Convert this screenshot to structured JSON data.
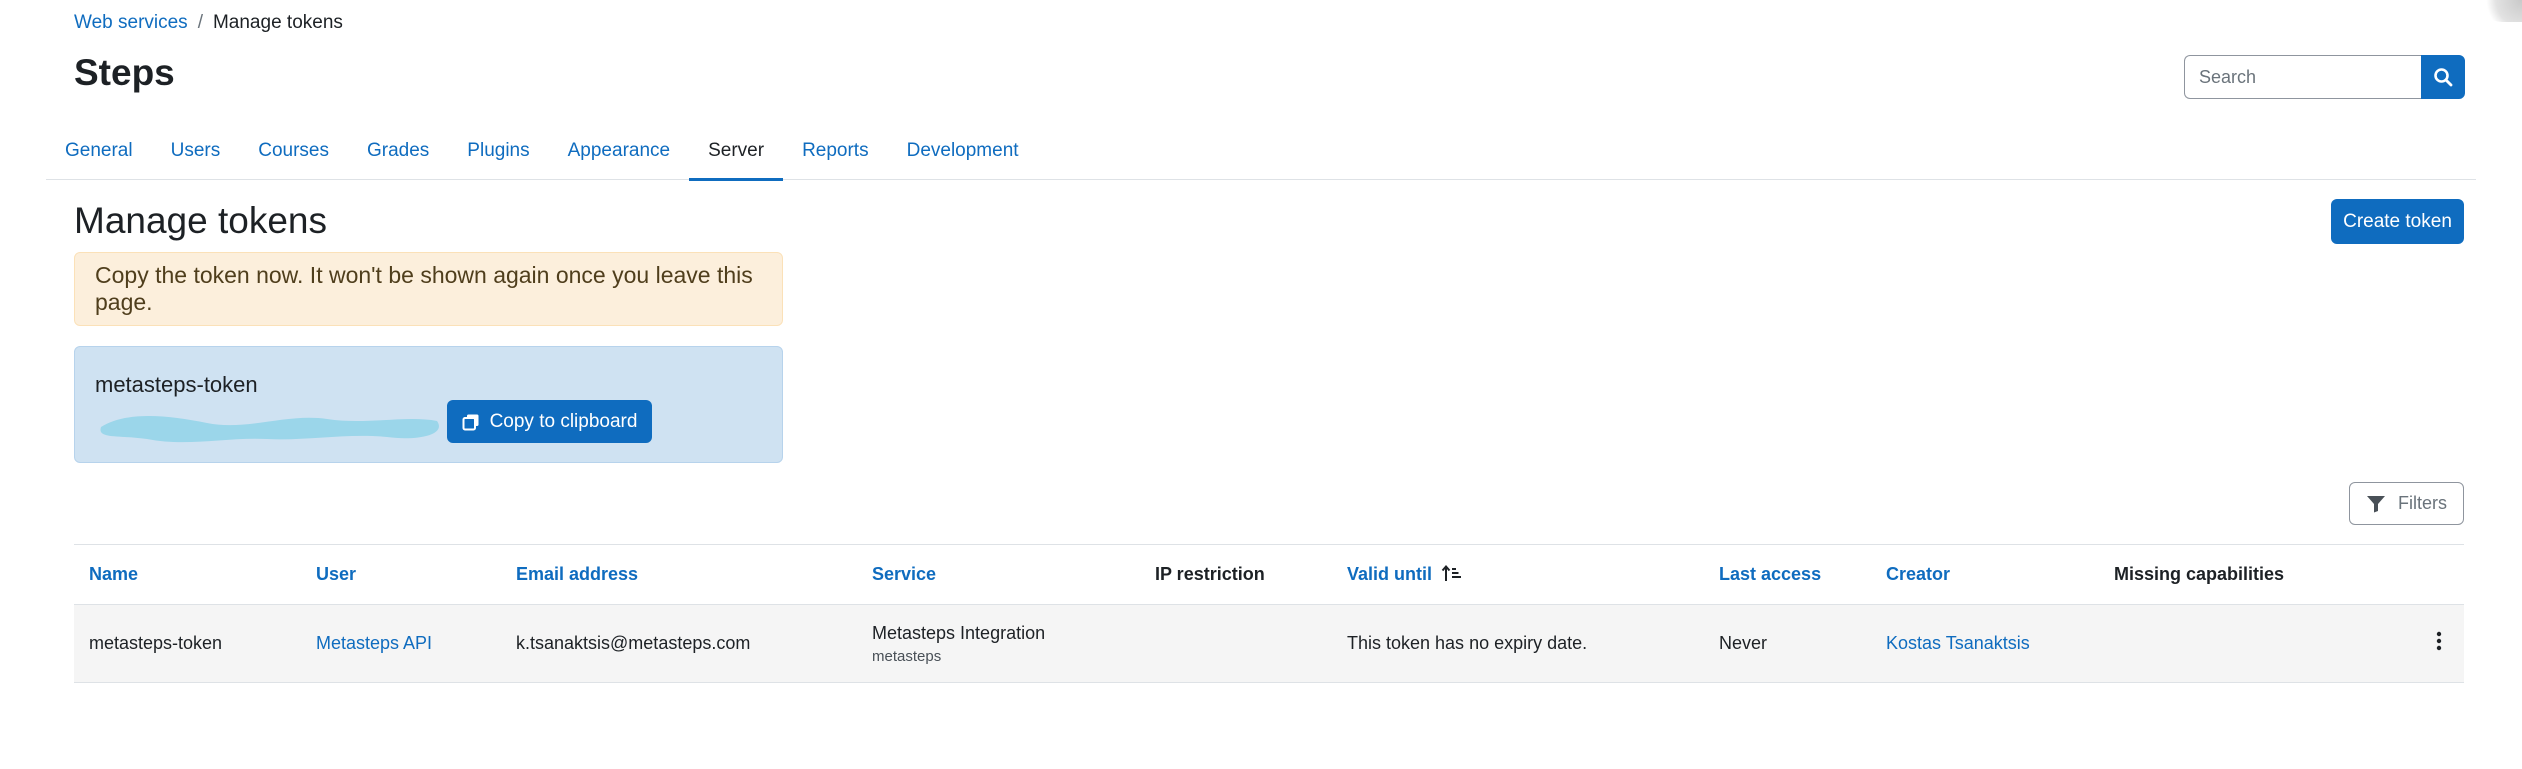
{
  "breadcrumb": {
    "parent": "Web services",
    "separator": "/",
    "current": "Manage tokens"
  },
  "page": {
    "title": "Steps"
  },
  "search": {
    "placeholder": "Search",
    "icon": "search-icon"
  },
  "tabs": [
    {
      "label": "General",
      "active": false
    },
    {
      "label": "Users",
      "active": false
    },
    {
      "label": "Courses",
      "active": false
    },
    {
      "label": "Grades",
      "active": false
    },
    {
      "label": "Plugins",
      "active": false
    },
    {
      "label": "Appearance",
      "active": false
    },
    {
      "label": "Server",
      "active": true
    },
    {
      "label": "Reports",
      "active": false
    },
    {
      "label": "Development",
      "active": false
    }
  ],
  "section": {
    "title": "Manage tokens",
    "create_button": "Create token"
  },
  "alert": {
    "message": "Copy the token now. It won't be shown again once you leave this page."
  },
  "token_box": {
    "name": "metasteps-token",
    "copy_button": "Copy to clipboard"
  },
  "filters": {
    "label": "Filters"
  },
  "table": {
    "headers": [
      "Name",
      "User",
      "Email address",
      "Service",
      "IP restriction",
      "Valid until",
      "Last access",
      "Creator",
      "Missing capabilities"
    ],
    "rows": [
      {
        "name": "metasteps-token",
        "user": "Metasteps API",
        "email": "k.tsanaktsis@metasteps.com",
        "service": "Metasteps Integration",
        "service_short": "metasteps",
        "ip_restriction": "",
        "valid_until": "This token has no expiry date.",
        "last_access": "Never",
        "creator": "Kostas Tsanaktsis",
        "missing_capabilities": ""
      }
    ]
  },
  "colors": {
    "accent": "#0f6cbf",
    "warning_bg": "#fcefdc",
    "info_bg": "#cfe2f2",
    "row_bg": "#f5f5f5"
  }
}
